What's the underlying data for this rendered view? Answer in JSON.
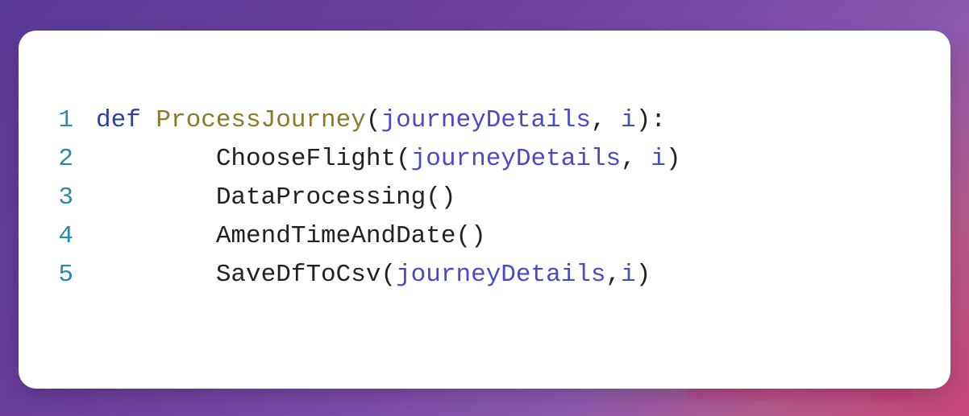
{
  "code": {
    "lines": [
      {
        "num": "1",
        "tokens": {
          "keyword": "def",
          "space1": " ",
          "funcdef": "ProcessJourney",
          "lparen": "(",
          "param1": "journeyDetails",
          "comma": ",",
          "space2": " ",
          "param2": "i",
          "rparen": ")",
          "colon": ":"
        }
      },
      {
        "num": "2",
        "tokens": {
          "indent": "        ",
          "call": "ChooseFlight",
          "lparen": "(",
          "arg1": "journeyDetails",
          "comma": ",",
          "space": " ",
          "arg2": "i",
          "rparen": ")"
        }
      },
      {
        "num": "3",
        "tokens": {
          "indent": "        ",
          "call": "DataProcessing",
          "lparen": "(",
          "rparen": ")"
        }
      },
      {
        "num": "4",
        "tokens": {
          "indent": "        ",
          "call": "AmendTimeAndDate",
          "lparen": "(",
          "rparen": ")"
        }
      },
      {
        "num": "5",
        "tokens": {
          "indent": "        ",
          "call": "SaveDfToCsv",
          "lparen": "(",
          "arg1": "journeyDetails",
          "comma": ",",
          "arg2": "i",
          "rparen": ")"
        }
      }
    ]
  }
}
